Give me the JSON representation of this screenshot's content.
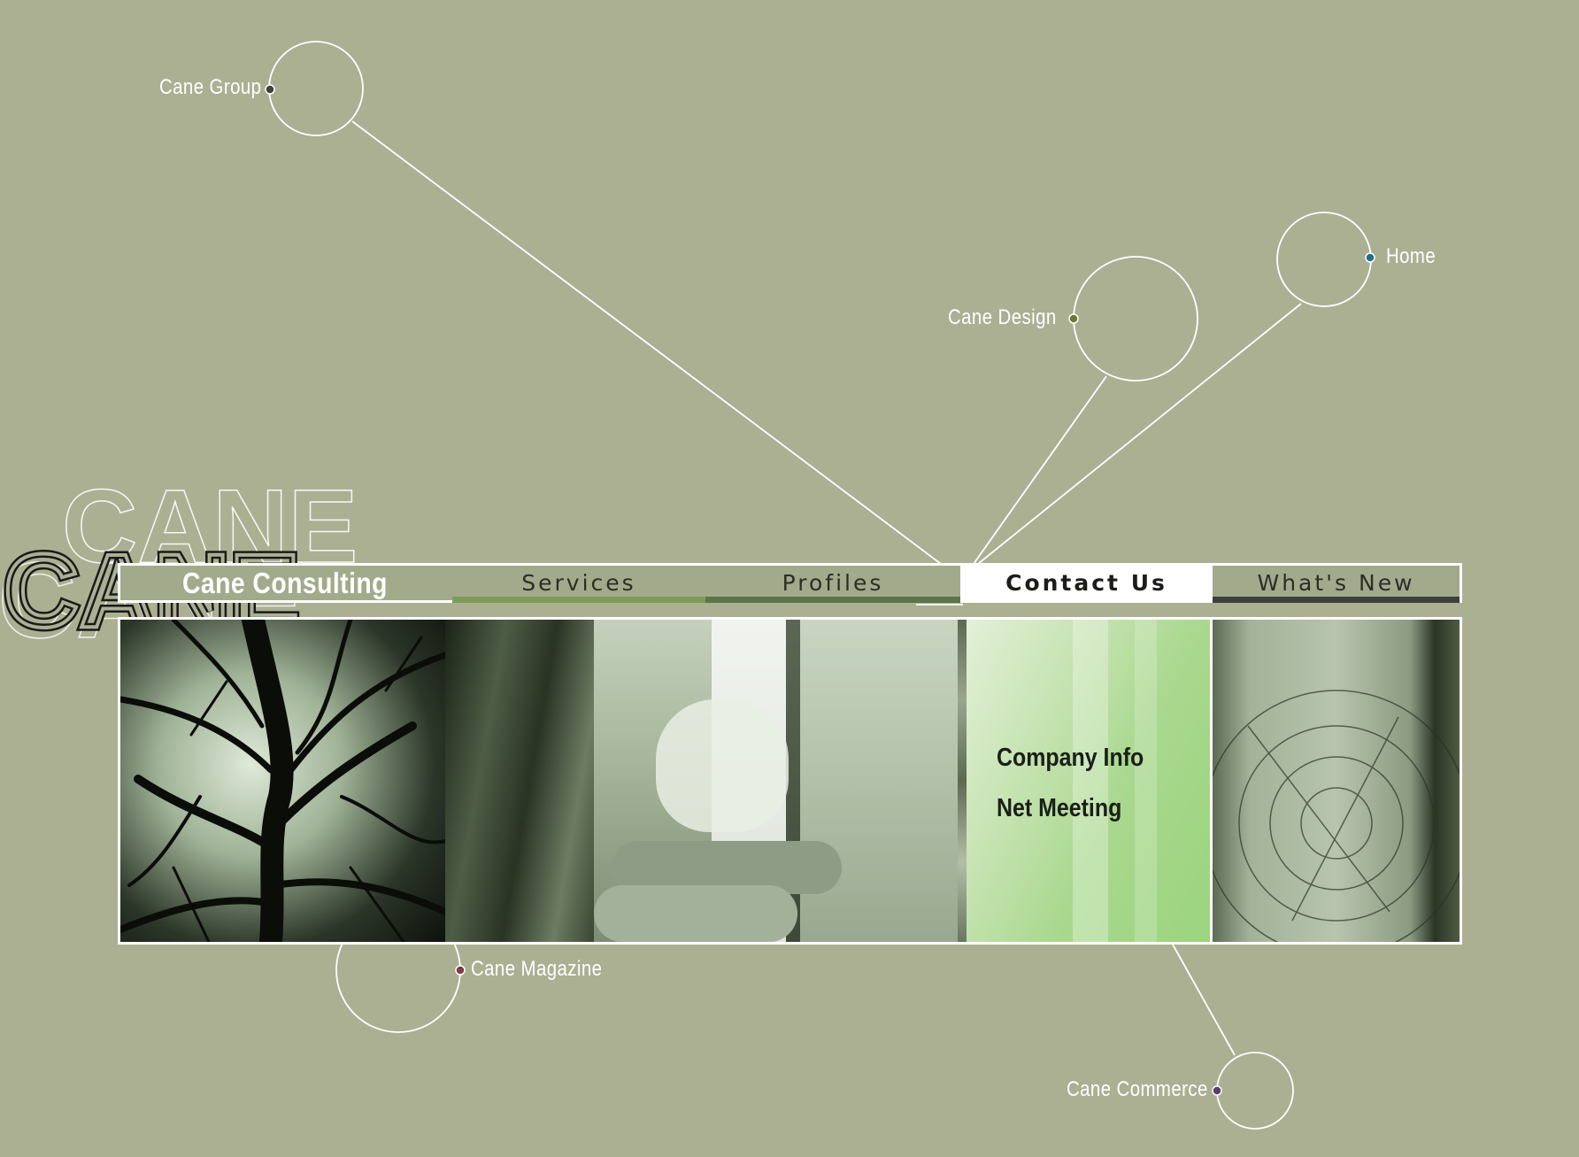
{
  "background_color": "#abb093",
  "brand": {
    "watermark": "CANE",
    "title": "Cane Consulting"
  },
  "orbit_links": [
    {
      "id": "cane-group",
      "label": "Cane Group",
      "dot_color": "#3f4238"
    },
    {
      "id": "home",
      "label": "Home",
      "dot_color": "#1f6f8a"
    },
    {
      "id": "cane-design",
      "label": "Cane Design",
      "dot_color": "#6b7a3a"
    },
    {
      "id": "cane-magazine",
      "label": "Cane Magazine",
      "dot_color": "#7a3d44"
    },
    {
      "id": "cane-commerce",
      "label": "Cane Commerce",
      "dot_color": "#5a3d6b"
    }
  ],
  "nav": {
    "items": [
      {
        "id": "services",
        "label": "Services",
        "bar_color": "#7e9a5a"
      },
      {
        "id": "profiles",
        "label": "Profiles",
        "bar_color": "#5f734a"
      },
      {
        "id": "contact",
        "label": "Contact Us",
        "active": true
      },
      {
        "id": "whats-new",
        "label": "What's New",
        "bar_color": "#3d3f3e"
      }
    ]
  },
  "contact_menu": {
    "items": [
      "Company Info",
      "Net Meeting"
    ],
    "panel_color": "#a8d88e"
  },
  "icons": [
    "orbit-circle-icon",
    "link-dot-icon"
  ]
}
